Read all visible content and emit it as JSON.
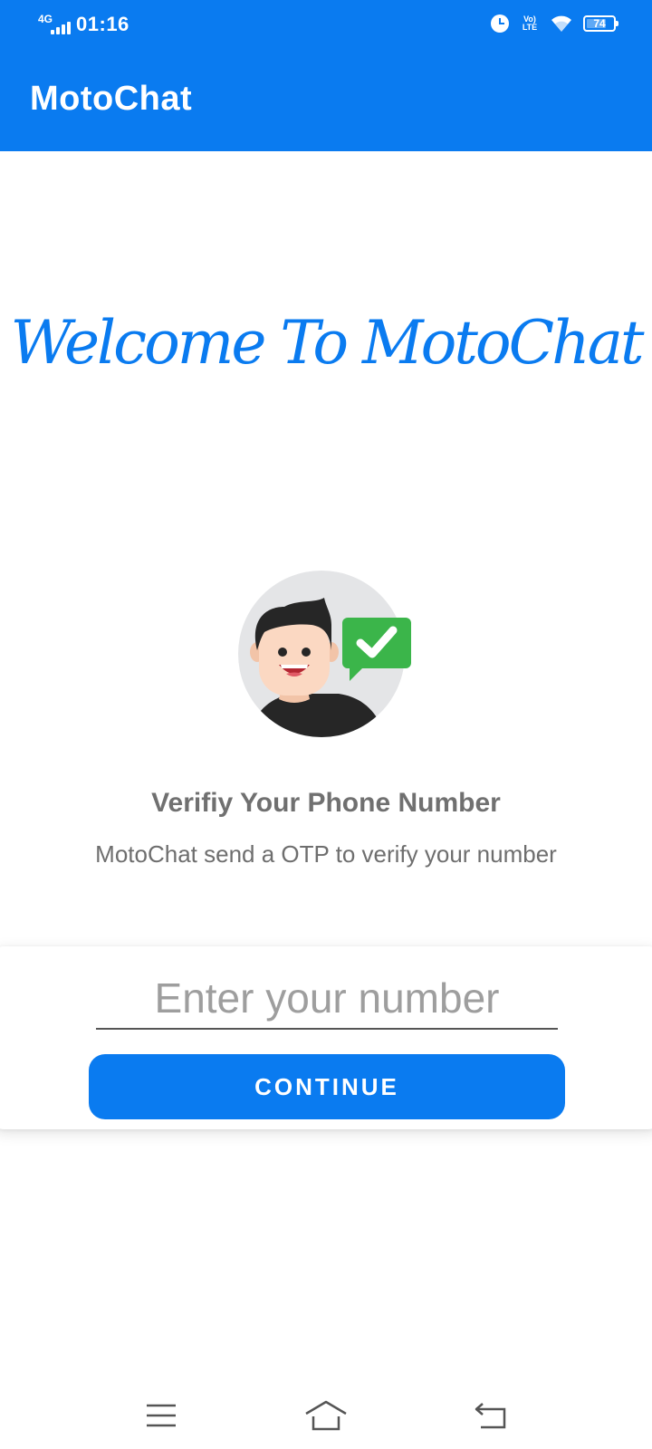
{
  "status_bar": {
    "network": "4G",
    "time": "01:16",
    "volte": "Vo) LTE",
    "battery_level": "74",
    "battery_fraction": 0.74,
    "icons": [
      "signal-icon",
      "alarm-icon",
      "volte-icon",
      "wifi-icon",
      "battery-icon"
    ]
  },
  "app_bar": {
    "title": "MotoChat"
  },
  "main": {
    "welcome": "Welcome To MotoChat",
    "illustration": "verified-user-illustration",
    "verify_title": "Verifiy Your Phone Number",
    "verify_subtitle": "MotoChat send a OTP to verify your number"
  },
  "form": {
    "number_placeholder": "Enter your number",
    "number_value": "",
    "continue_label": "CONTINUE"
  },
  "nav_bar": {
    "icons": [
      "menu-icon",
      "home-icon",
      "back-icon"
    ]
  },
  "colors": {
    "primary": "#0a7bf0",
    "check_green": "#3bb54a",
    "avatar_bg": "#e4e5e7",
    "text_gray": "#707070"
  }
}
